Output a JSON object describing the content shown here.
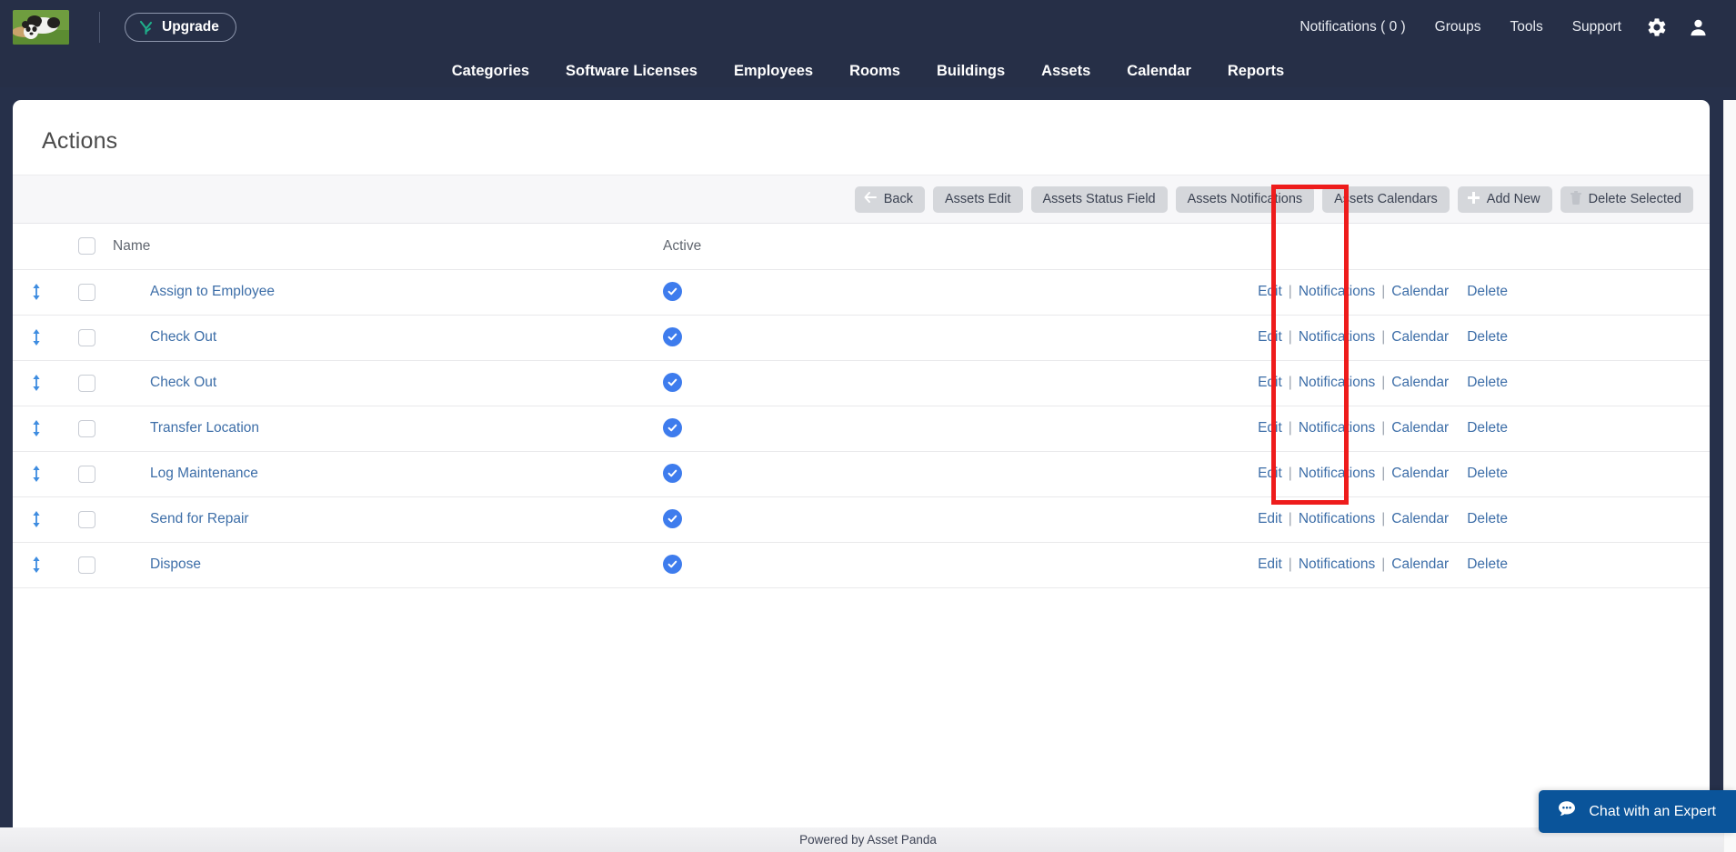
{
  "topbar": {
    "logo_alt": "panda-logo",
    "upgrade_label": "Upgrade",
    "upgrade_icon": "upgrade-sprout-icon",
    "links": [
      {
        "label": "Notifications ( 0 )",
        "name": "notifications"
      },
      {
        "label": "Groups",
        "name": "groups"
      },
      {
        "label": "Tools",
        "name": "tools"
      },
      {
        "label": "Support",
        "name": "support"
      }
    ],
    "icons": [
      {
        "name": "gear-icon"
      },
      {
        "name": "user-icon"
      }
    ]
  },
  "subnav": {
    "items": [
      {
        "label": "Categories"
      },
      {
        "label": "Software Licenses"
      },
      {
        "label": "Employees"
      },
      {
        "label": "Rooms"
      },
      {
        "label": "Buildings"
      },
      {
        "label": "Assets"
      },
      {
        "label": "Calendar"
      },
      {
        "label": "Reports"
      }
    ]
  },
  "page": {
    "title": "Actions"
  },
  "toolbar": {
    "buttons": [
      {
        "label": "Back",
        "icon": "arrow-left-icon"
      },
      {
        "label": "Assets Edit",
        "icon": ""
      },
      {
        "label": "Assets Status Field",
        "icon": ""
      },
      {
        "label": "Assets Notifications",
        "icon": ""
      },
      {
        "label": "Assets Calendars",
        "icon": ""
      },
      {
        "label": "Add New",
        "icon": "plus-icon"
      },
      {
        "label": "Delete Selected",
        "icon": "trash-icon"
      }
    ]
  },
  "table": {
    "headers": {
      "name": "Name",
      "active": "Active"
    },
    "row_actions": {
      "edit": "Edit",
      "notifications": "Notifications",
      "calendar": "Calendar",
      "delete": "Delete",
      "separator": "|"
    },
    "rows": [
      {
        "name": "Assign to Employee",
        "active": true
      },
      {
        "name": "Check Out",
        "active": true
      },
      {
        "name": "Check Out",
        "active": true
      },
      {
        "name": "Transfer Location",
        "active": true
      },
      {
        "name": "Log Maintenance",
        "active": true
      },
      {
        "name": "Send for Repair",
        "active": true
      },
      {
        "name": "Dispose",
        "active": true
      }
    ]
  },
  "annotation": {
    "color": "#ee1c1c",
    "target": "calendar-column"
  },
  "footer": {
    "text": "Powered by Asset Panda"
  },
  "chat": {
    "label": "Chat with an Expert",
    "icon": "chat-bubble-icon"
  },
  "colors": {
    "nav_bg": "#262f47",
    "link_blue": "#3d6ea8",
    "active_blue": "#3e7ced",
    "chat_blue": "#0a549a",
    "annotation_red": "#ee1c1c"
  }
}
